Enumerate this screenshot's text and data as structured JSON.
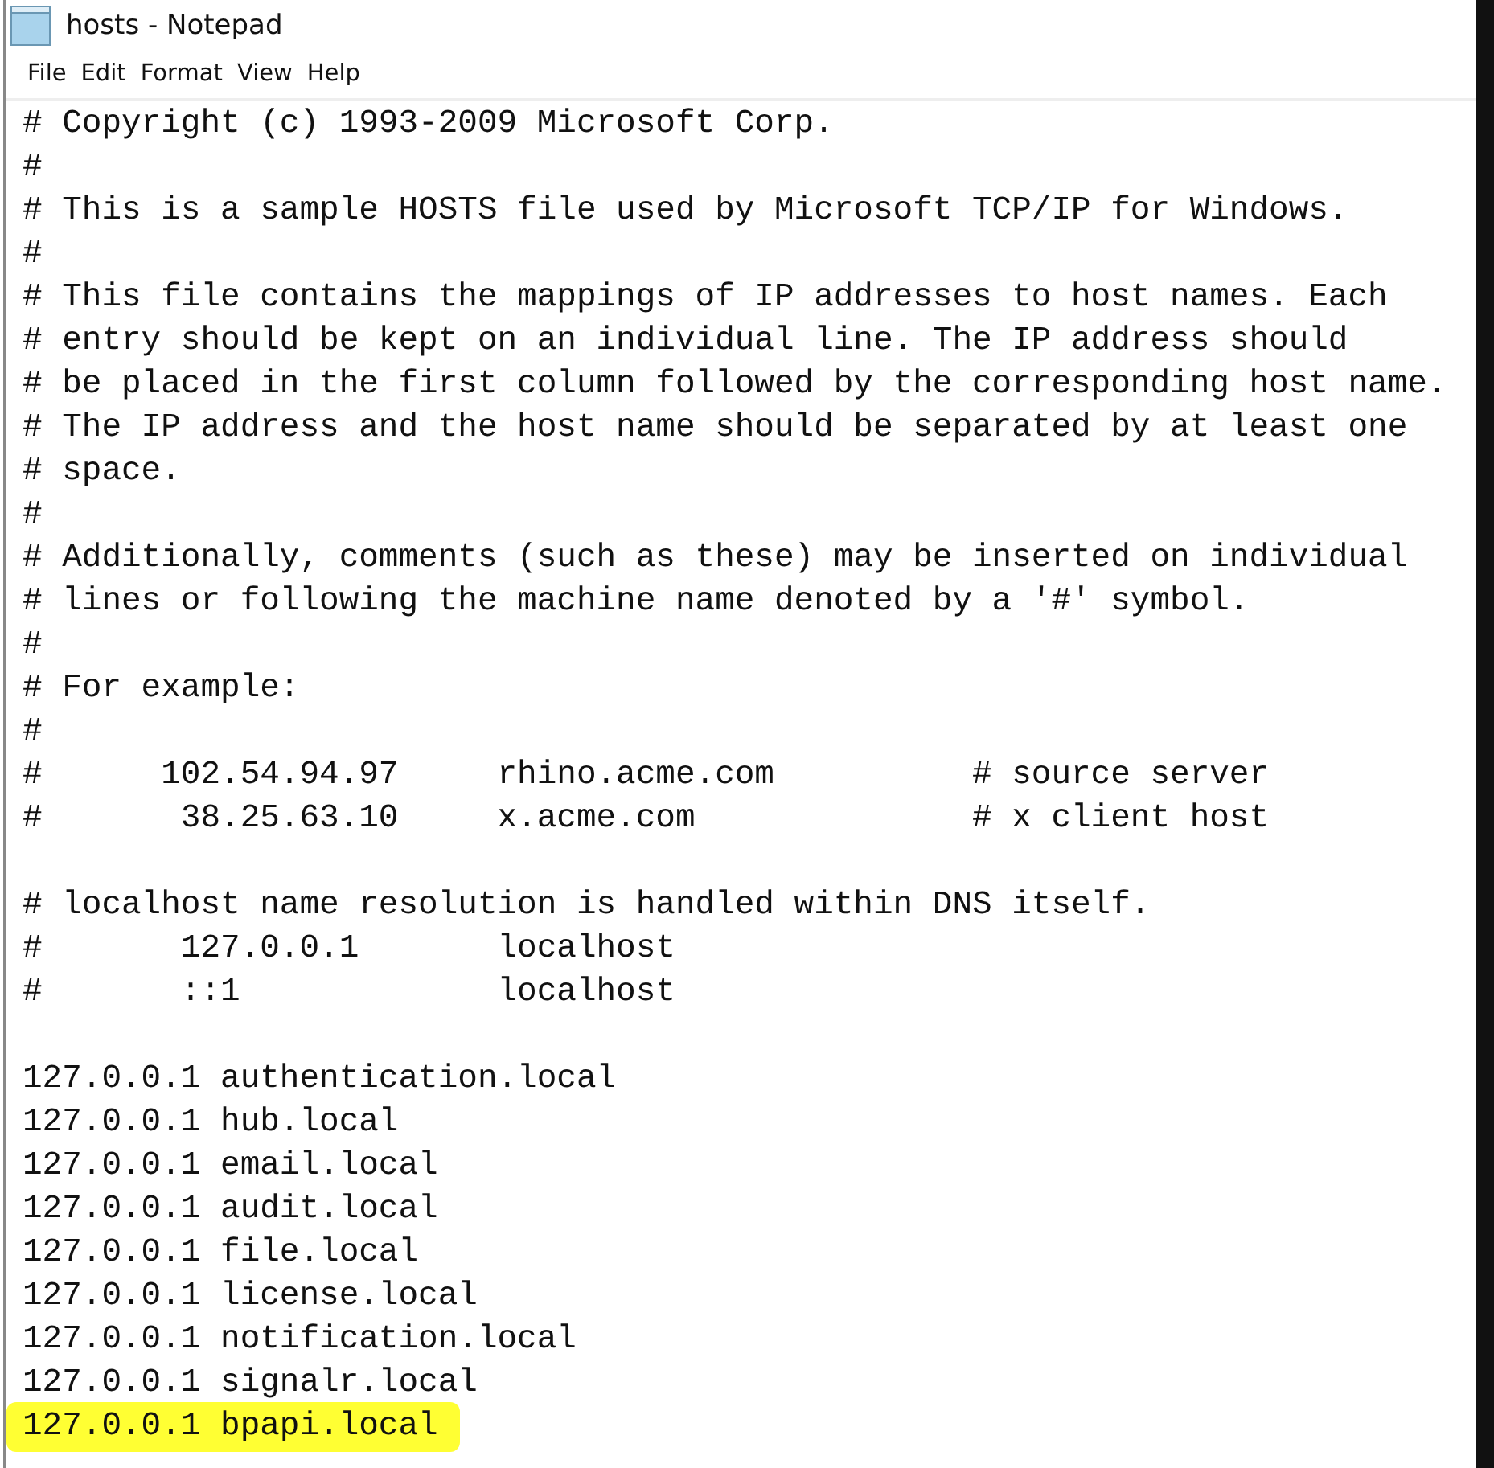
{
  "window": {
    "title": "hosts - Notepad"
  },
  "menu": [
    "File",
    "Edit",
    "Format",
    "View",
    "Help"
  ],
  "lines": [
    {
      "kind": "text",
      "text": "# Copyright (c) 1993-2009 Microsoft Corp.",
      "highlighted": false
    },
    {
      "kind": "text",
      "text": "#",
      "highlighted": false
    },
    {
      "kind": "text",
      "text": "# This is a sample HOSTS file used by Microsoft TCP/IP for Windows.",
      "highlighted": false
    },
    {
      "kind": "text",
      "text": "#",
      "highlighted": false
    },
    {
      "kind": "text",
      "text": "# This file contains the mappings of IP addresses to host names. Each",
      "highlighted": false
    },
    {
      "kind": "text",
      "text": "# entry should be kept on an individual line. The IP address should",
      "highlighted": false
    },
    {
      "kind": "text",
      "text": "# be placed in the first column followed by the corresponding host name.",
      "highlighted": false
    },
    {
      "kind": "text",
      "text": "# The IP address and the host name should be separated by at least one",
      "highlighted": false
    },
    {
      "kind": "text",
      "text": "# space.",
      "highlighted": false
    },
    {
      "kind": "text",
      "text": "#",
      "highlighted": false
    },
    {
      "kind": "text",
      "text": "# Additionally, comments (such as these) may be inserted on individual",
      "highlighted": false
    },
    {
      "kind": "text",
      "text": "# lines or following the machine name denoted by a '#' symbol.",
      "highlighted": false
    },
    {
      "kind": "text",
      "text": "#",
      "highlighted": false
    },
    {
      "kind": "text",
      "text": "# For example:",
      "highlighted": false
    },
    {
      "kind": "text",
      "text": "#",
      "highlighted": false
    },
    {
      "kind": "text",
      "text": "#      102.54.94.97     rhino.acme.com          # source server",
      "highlighted": false
    },
    {
      "kind": "text",
      "text": "#       38.25.63.10     x.acme.com              # x client host",
      "highlighted": false
    },
    {
      "kind": "blank"
    },
    {
      "kind": "text",
      "text": "# localhost name resolution is handled within DNS itself.",
      "highlighted": false
    },
    {
      "kind": "text",
      "text": "#       127.0.0.1       localhost",
      "highlighted": false
    },
    {
      "kind": "text",
      "text": "#       ::1             localhost",
      "highlighted": false
    },
    {
      "kind": "blank"
    },
    {
      "kind": "text",
      "text": "127.0.0.1 authentication.local",
      "highlighted": false
    },
    {
      "kind": "text",
      "text": "127.0.0.1 hub.local",
      "highlighted": false
    },
    {
      "kind": "text",
      "text": "127.0.0.1 email.local",
      "highlighted": false
    },
    {
      "kind": "text",
      "text": "127.0.0.1 audit.local",
      "highlighted": false
    },
    {
      "kind": "text",
      "text": "127.0.0.1 file.local",
      "highlighted": false
    },
    {
      "kind": "text",
      "text": "127.0.0.1 license.local",
      "highlighted": false
    },
    {
      "kind": "text",
      "text": "127.0.0.1 notification.local",
      "highlighted": false
    },
    {
      "kind": "text",
      "text": "127.0.0.1 signalr.local",
      "highlighted": false
    },
    {
      "kind": "text",
      "text": "127.0.0.1 bpapi.local",
      "highlighted": true
    }
  ]
}
